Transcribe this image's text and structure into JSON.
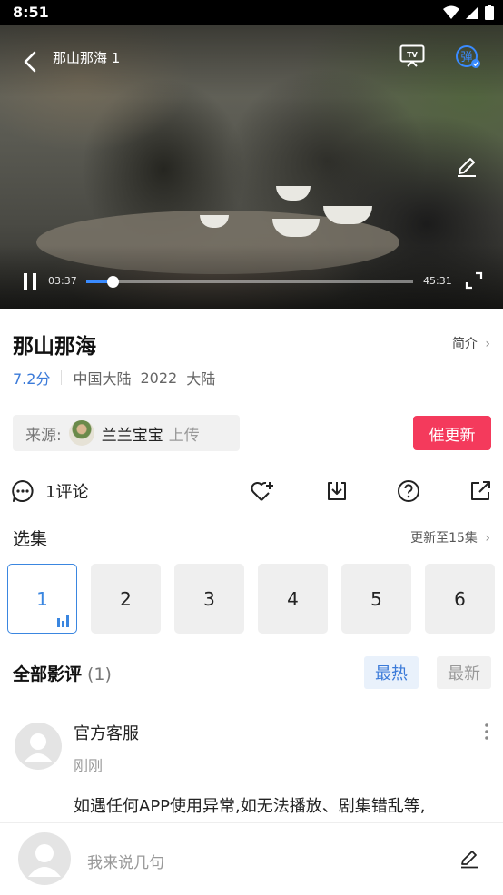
{
  "status_bar": {
    "time": "8:51",
    "icons": [
      "wifi-icon",
      "signal-icon",
      "battery-icon"
    ]
  },
  "player": {
    "episode_title": "那山那海 1",
    "current_time": "03:37",
    "total_time": "45:31",
    "progress": 0.0795,
    "danmu_label": "弹",
    "tv_label": "TV",
    "accent_color": "#3a8bff"
  },
  "show": {
    "title": "那山那海",
    "intro_label": "简介",
    "score": "7.2分",
    "region": "中国大陆",
    "year": "2022",
    "language": "大陆"
  },
  "source": {
    "label": "来源:",
    "uploader": "兰兰宝宝",
    "upload_suffix": "上传"
  },
  "urge_update_label": "催更新",
  "actions": {
    "comments_label": "1评论",
    "icons": [
      "heart-plus-icon",
      "download-icon",
      "help-icon",
      "share-icon"
    ]
  },
  "episodes": {
    "title": "选集",
    "update_label": "更新至15集",
    "items": [
      "1",
      "2",
      "3",
      "4",
      "5",
      "6"
    ],
    "active_index": 0
  },
  "reviews": {
    "title": "全部影评",
    "count": "(1)",
    "sort_hot": "最热",
    "sort_new": "最新",
    "items": [
      {
        "name": "官方客服",
        "time": "刚刚",
        "text": "如遇任何APP使用异常,如无法播放、剧集错乱等,"
      }
    ]
  },
  "comment_bar": {
    "placeholder": "我来说几句"
  },
  "colors": {
    "brand_red": "#f43a5c",
    "link_blue": "#3a7ad9"
  }
}
